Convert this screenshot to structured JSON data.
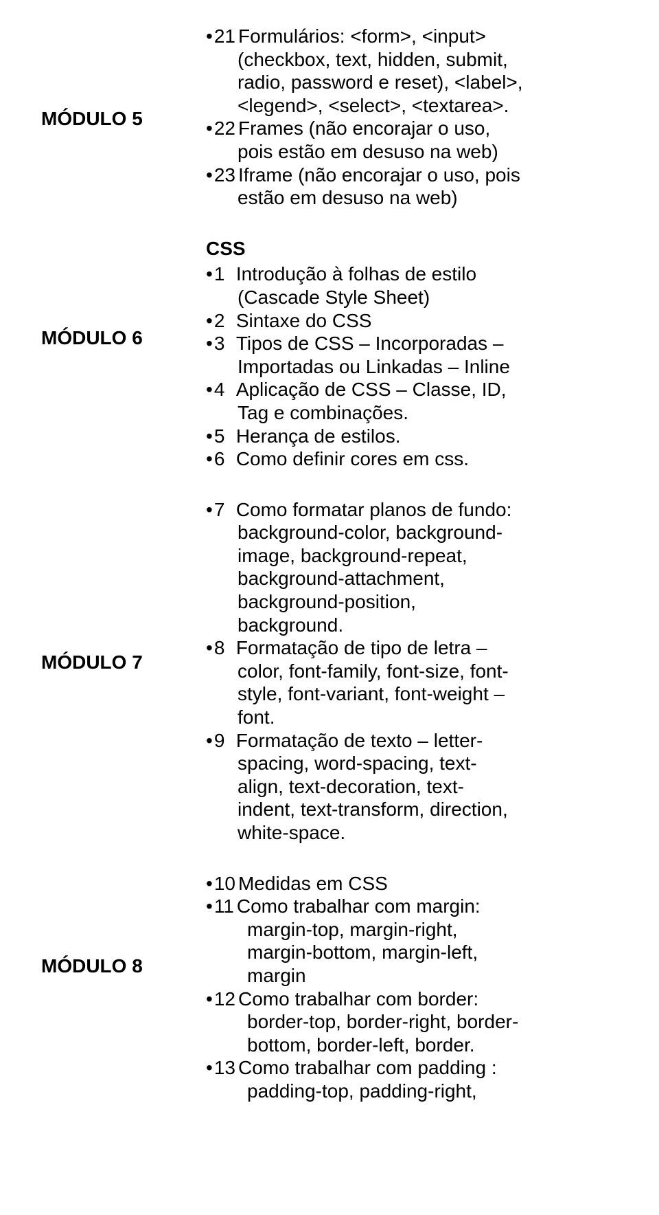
{
  "modules": {
    "m5": {
      "label": "MÓDULO 5",
      "items": [
        {
          "num": "21",
          "line1": "Formulários: <form>, <input>",
          "cont": [
            "(checkbox, text, hidden, submit,",
            "radio, password e reset), <label>,",
            "<legend>, <select>, <textarea>."
          ]
        },
        {
          "num": "22",
          "line1": "Frames (não encorajar o uso,",
          "cont": [
            "pois estão em desuso na web)"
          ]
        },
        {
          "num": "23",
          "line1": "Iframe (não encorajar o uso, pois",
          "cont": [
            "estão em desuso na web)"
          ]
        }
      ]
    },
    "m6": {
      "label": "MÓDULO 6",
      "heading": "CSS",
      "items": [
        {
          "num": "1",
          "line1": "Introdução à folhas de estilo",
          "cont": [
            "(Cascade Style Sheet)"
          ]
        },
        {
          "num": "2",
          "line1": "Sintaxe do CSS",
          "cont": []
        },
        {
          "num": "3",
          "line1": "Tipos de CSS – Incorporadas –",
          "cont": [
            "Importadas ou Linkadas – Inline"
          ]
        },
        {
          "num": "4",
          "line1": "Aplicação de CSS – Classe, ID,",
          "cont": [
            "Tag e combinações."
          ]
        },
        {
          "num": "5",
          "line1": "Herança de estilos.",
          "cont": []
        },
        {
          "num": "6",
          "line1": "Como definir cores em css.",
          "cont": []
        }
      ]
    },
    "m7": {
      "label": "MÓDULO 7",
      "items": [
        {
          "num": "7",
          "line1": "Como formatar planos de fundo:",
          "cont": [
            "background-color, background-",
            "image, background-repeat,",
            "background-attachment,",
            "background-position,",
            "background."
          ]
        },
        {
          "num": "8",
          "line1": "Formatação de tipo de letra –",
          "cont": [
            "color, font-family, font-size, font-",
            "style, font-variant, font-weight –",
            "font."
          ]
        },
        {
          "num": "9",
          "line1": "Formatação de texto – letter-",
          "cont": [
            "spacing, word-spacing, text-",
            "align, text-decoration, text-",
            "indent, text-transform, direction,",
            "white-space."
          ]
        }
      ]
    },
    "m8": {
      "label": "MÓDULO 8",
      "items": [
        {
          "num": "10",
          "line1": "Medidas em CSS",
          "cont": []
        },
        {
          "num": "11",
          "line1": "Como trabalhar com margin:",
          "cont": [
            "margin-top, margin-right,",
            "margin-bottom, margin-left,",
            "margin"
          ]
        },
        {
          "num": "12",
          "line1": "Como trabalhar com border:",
          "cont": [
            "border-top, border-right, border-",
            "bottom, border-left, border."
          ]
        },
        {
          "num": "13",
          "line1": "Como trabalhar com padding :",
          "cont": [
            "padding-top, padding-right,"
          ]
        }
      ]
    }
  }
}
